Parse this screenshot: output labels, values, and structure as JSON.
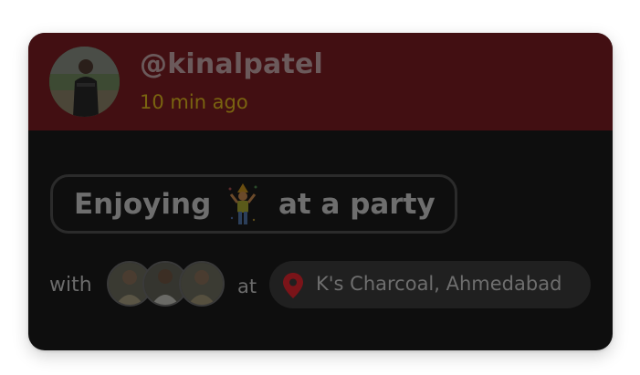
{
  "post": {
    "username": "@kinalpatel",
    "time_ago": "10 min ago",
    "activity": {
      "prefix": "Enjoying",
      "emoji_icon": "party-person-emoji-icon",
      "suffix": "at a party"
    },
    "with_label": "with",
    "friends_icon": "friend-avatar-icon",
    "at_label": "at",
    "location": "K's Charcoal, Ahmedabad",
    "location_icon": "map-pin-icon"
  },
  "colors": {
    "header_bg": "#420f12",
    "card_bg": "#0e0e0e",
    "username": "#6b5a5b",
    "time": "#7a6410",
    "pin": "#7a1419",
    "location_pill_bg": "#202020"
  }
}
